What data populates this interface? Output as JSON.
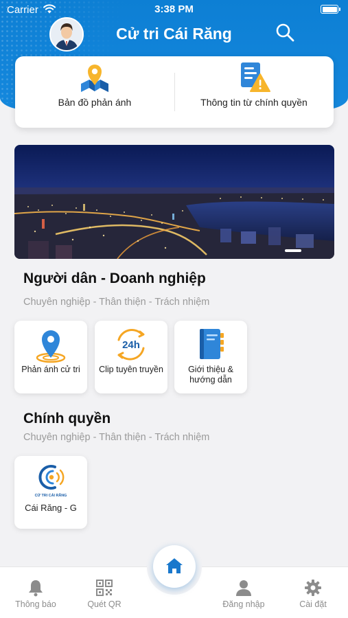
{
  "status_bar": {
    "carrier": "Carrier",
    "time": "3:38 PM"
  },
  "header": {
    "title": "Cử tri Cái Răng",
    "avatar_icon": "user-avatar",
    "search_icon": "search-icon"
  },
  "quick_actions": [
    {
      "label": "Bản đồ phản ánh",
      "icon": "map-pin-icon"
    },
    {
      "label": "Thông tin từ chính quyền",
      "icon": "document-warning-icon"
    }
  ],
  "banner": {
    "alt": "city-night-photo"
  },
  "citizen_section": {
    "title": "Người dân - Doanh nghiệp",
    "subtitle": "Chuyên nghiệp - Thân thiện - Trách nhiệm",
    "tiles": [
      {
        "label": "Phản ánh cử tri",
        "icon": "location-icon"
      },
      {
        "label": "Clip tuyên truyền",
        "icon": "24h-icon"
      },
      {
        "label": "Giới thiệu & hướng dẫn",
        "icon": "book-icon"
      }
    ]
  },
  "government_section": {
    "title": "Chính quyền",
    "subtitle": "Chuyên nghiệp - Thân thiện - Trách nhiệm",
    "tiles": [
      {
        "label": "Cái Răng - G",
        "icon": "cu-tri-cai-rang-logo",
        "logo_text": "CỬ TRI CÁI RĂNG"
      }
    ]
  },
  "tabbar": {
    "items": [
      {
        "label": "Thông báo",
        "icon": "bell-icon"
      },
      {
        "label": "Quét QR",
        "icon": "qr-icon"
      },
      {
        "label": "Đăng nhập",
        "icon": "person-icon"
      },
      {
        "label": "Cài đặt",
        "icon": "gear-icon"
      }
    ],
    "home_icon": "home-icon"
  },
  "colors": {
    "primary": "#1588dd",
    "accent_orange": "#f5a623",
    "text_dark": "#111111",
    "text_muted": "#9a9a9a"
  }
}
